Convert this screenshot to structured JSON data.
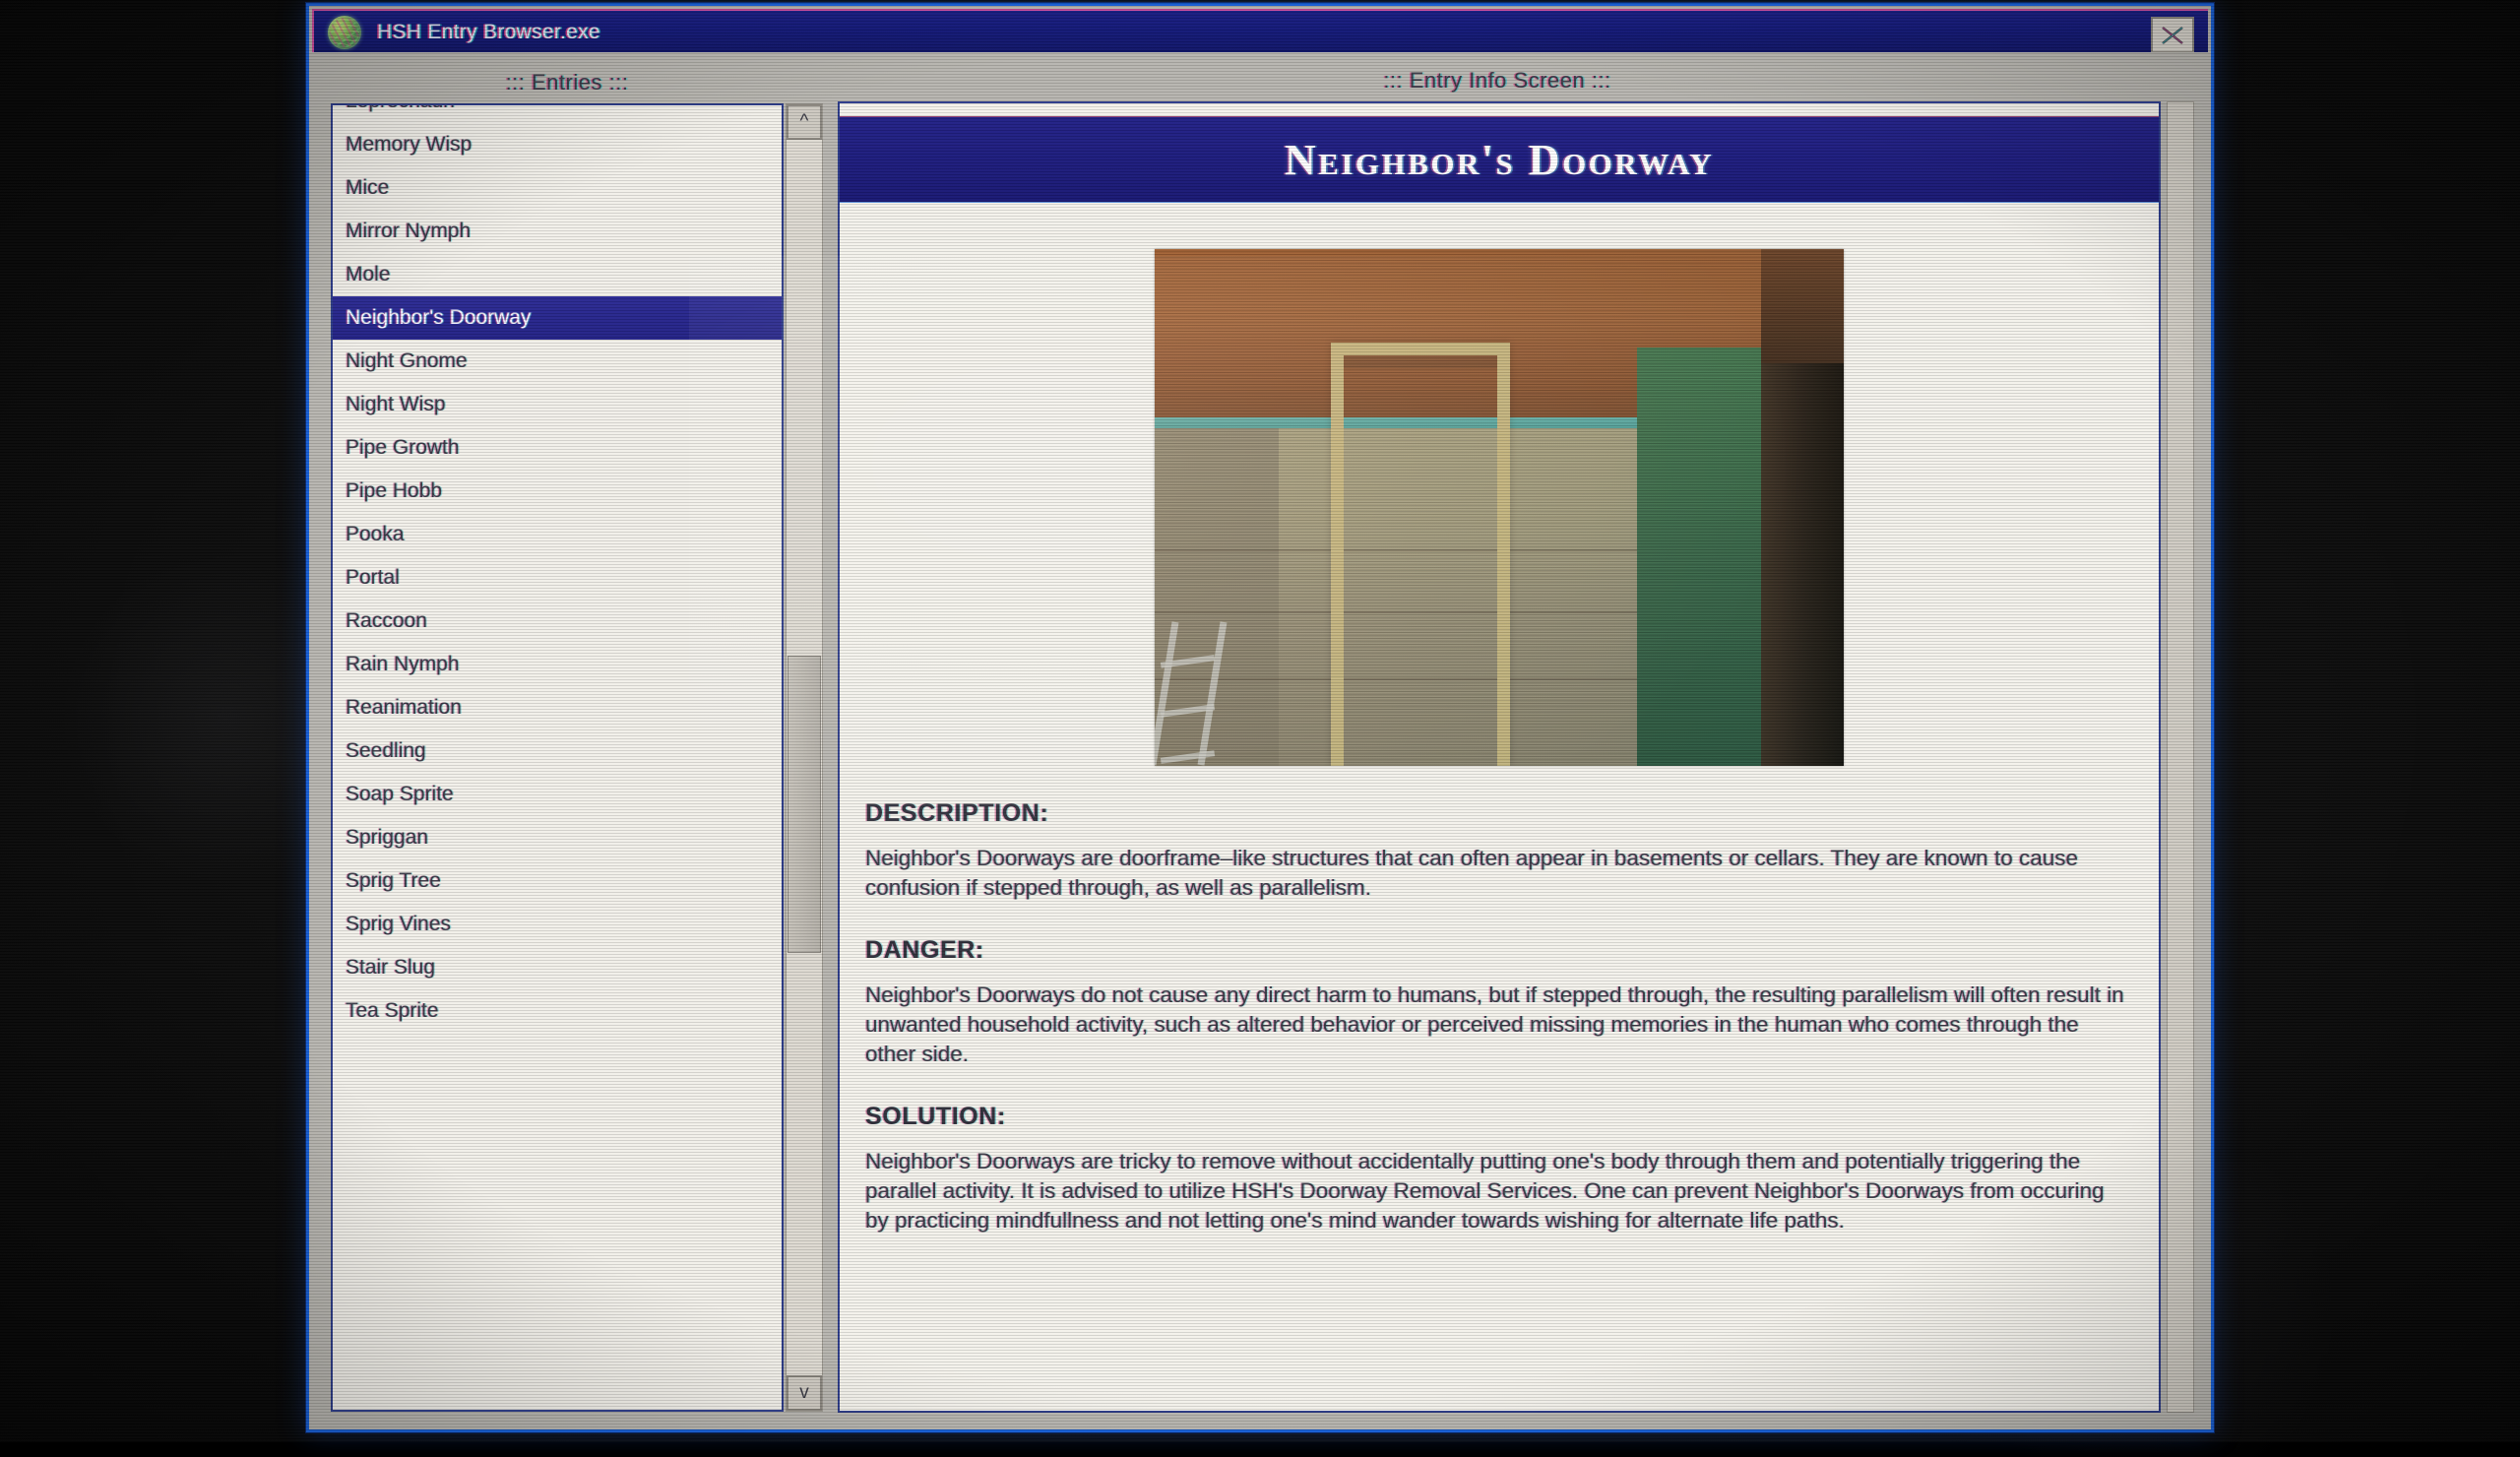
{
  "window": {
    "title": "HSH Entry Browser.exe",
    "icon": "globe-icon",
    "close_label": "close-icon",
    "accent_titlebar": "#141a7a",
    "border_color": "#1760d8"
  },
  "panels": {
    "entries_title": "::: Entries :::",
    "info_title": "::: Entry Info Screen :::"
  },
  "entries": {
    "items": [
      "Leprechaun",
      "Memory Wisp",
      "Mice",
      "Mirror Nymph",
      "Mole",
      "Neighbor's Doorway",
      "Night Gnome",
      "Night Wisp",
      "Pipe Growth",
      "Pipe Hobb",
      "Pooka",
      "Portal",
      "Raccoon",
      "Rain Nymph",
      "Reanimation",
      "Seedling",
      "Soap Sprite",
      "Spriggan",
      "Sprig Tree",
      "Sprig Vines",
      "Stair Slug",
      "Tea Sprite"
    ],
    "selected": "Neighbor's Doorway",
    "selected_index": 5,
    "scroll_up_glyph": "^",
    "scroll_down_glyph": "v",
    "highlight_color": "#2c2b94"
  },
  "entry": {
    "title": "Neighbor's Doorway",
    "image_alt": "doorframe-standing-against-basement-wall",
    "sections": [
      {
        "heading": "DESCRIPTION:",
        "body": "Neighbor's Doorways are doorframe–like structures that can often appear in basements or cellars. They are known to cause confusion if stepped through, as well as parallelism."
      },
      {
        "heading": "DANGER:",
        "body": "Neighbor's Doorways do not cause any direct harm to humans, but if stepped through, the resulting parallelism will often result in unwanted household activity, such as altered behavior or perceived missing memories in the human who comes through the other side."
      },
      {
        "heading": "SOLUTION:",
        "body": "Neighbor's Doorways are tricky to remove without accidentally putting one's body through them and potentially triggering the parallel activity. It is advised to utilize HSH's Doorway Removal Services. One can prevent Neighbor's Doorways from occuring by practicing mindfullness and not letting one's mind wander towards wishing for alternate life paths."
      }
    ]
  }
}
